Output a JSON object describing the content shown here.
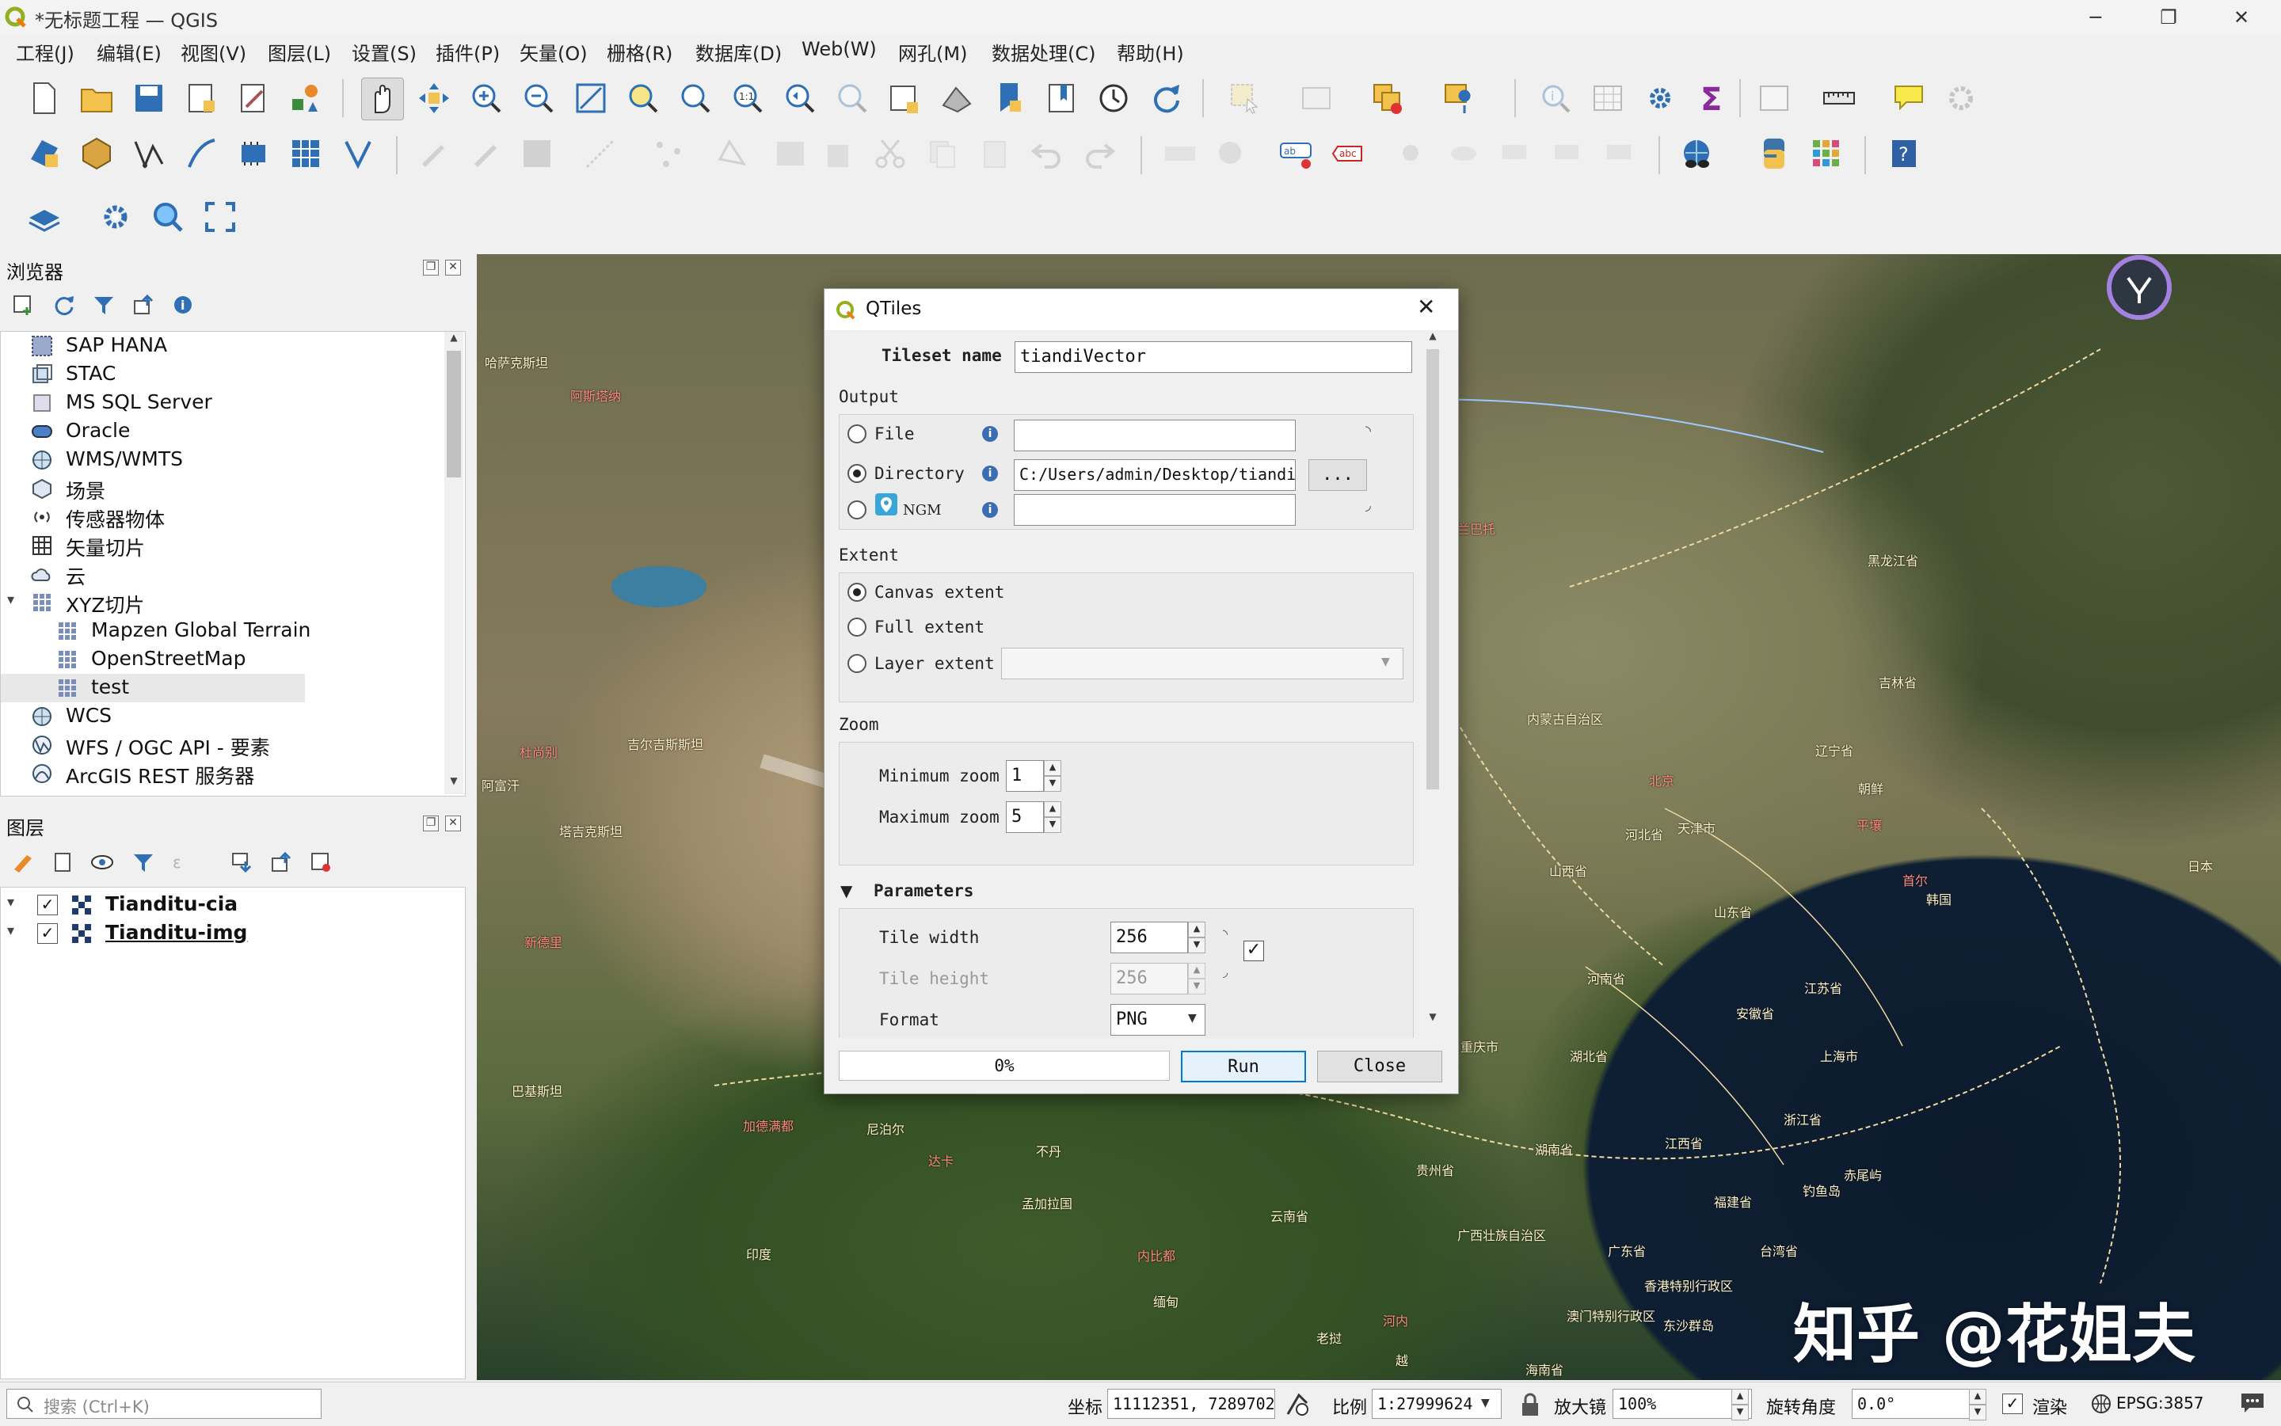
{
  "window": {
    "title": "*无标题工程 — QGIS"
  },
  "menu": [
    "工程(J)",
    "编辑(E)",
    "视图(V)",
    "图层(L)",
    "设置(S)",
    "插件(P)",
    "矢量(O)",
    "栅格(R)",
    "数据库(D)",
    "Web(W)",
    "网孔(M)",
    "数据处理(C)",
    "帮助(H)"
  ],
  "browser": {
    "title": "浏览器",
    "items": [
      "SAP HANA",
      "STAC",
      "MS SQL Server",
      "Oracle",
      "WMS/WMTS",
      "场景",
      "传感器物体",
      "矢量切片",
      "云",
      "XYZ切片",
      "Mapzen Global Terrain",
      "OpenStreetMap",
      "test",
      "WCS",
      "WFS / OGC API - 要素",
      "ArcGIS REST 服务器"
    ]
  },
  "layers": {
    "title": "图层",
    "items": [
      "Tianditu-cia",
      "Tianditu-img"
    ]
  },
  "dialog": {
    "title": "QTiles",
    "tileset_label": "Tileset name",
    "tileset_value": "tiandiVector",
    "output_label": "Output",
    "file_label": "File",
    "directory_label": "Directory",
    "directory_value": "C:/Users/admin/Desktop/tianditu",
    "browse_label": "...",
    "ngm_label": "NGM",
    "extent_label": "Extent",
    "canvas_extent": "Canvas extent",
    "full_extent": "Full extent",
    "layer_extent": "Layer extent",
    "zoom_label": "Zoom",
    "min_zoom_label": "Minimum zoom",
    "min_zoom_value": "1",
    "max_zoom_label": "Maximum zoom",
    "max_zoom_value": "5",
    "parameters_label": "Parameters",
    "tile_width_label": "Tile width",
    "tile_width_value": "256",
    "tile_height_label": "Tile height",
    "tile_height_value": "256",
    "format_label": "Format",
    "format_value": "PNG",
    "progress_text": "0%",
    "progress": 0,
    "run_label": "Run",
    "close_label": "Close"
  },
  "map_labels": [
    "黑龙江省",
    "吉林省",
    "辽宁省",
    "内蒙古自治区",
    "北京",
    "河北省",
    "天津市",
    "朝鲜",
    "平壤",
    "首尔",
    "韩国",
    "日本",
    "山西省",
    "山东省",
    "河南省",
    "江苏省",
    "安徽省",
    "湖北省",
    "上海市",
    "重庆市",
    "浙江省",
    "江西省",
    "湖南省",
    "贵州省",
    "福建省",
    "云南省",
    "广西壮族自治区",
    "广东省",
    "台湾省",
    "香港特别行政区",
    "澳门特别行政区",
    "海南省",
    "东沙群岛",
    "钓鱼岛",
    "赤尾屿",
    "尼泊尔",
    "不丹",
    "孟加拉国",
    "印度",
    "缅甸",
    "老挝",
    "越",
    "巴基斯坦",
    "吉尔吉斯斯坦",
    "塔吉克斯坦",
    "阿富汗",
    "哈萨克斯坦",
    "乌兰巴托",
    "阿斯塔纳",
    "杜尚别",
    "新德里",
    "加德满都",
    "达卡",
    "内比都",
    "河内"
  ],
  "watermark": "知乎 @花姐夫",
  "status": {
    "search_placeholder": "搜索 (Ctrl+K)",
    "coord_label": "坐标",
    "coord_value": "11112351, 7289702",
    "scale_label": "比例",
    "scale_value": "1:27999624",
    "magnifier_label": "放大镜",
    "magnifier_value": "100%",
    "rotation_label": "旋转角度",
    "rotation_value": "0.0°",
    "render_label": "渲染",
    "crs": "EPSG:3857"
  }
}
